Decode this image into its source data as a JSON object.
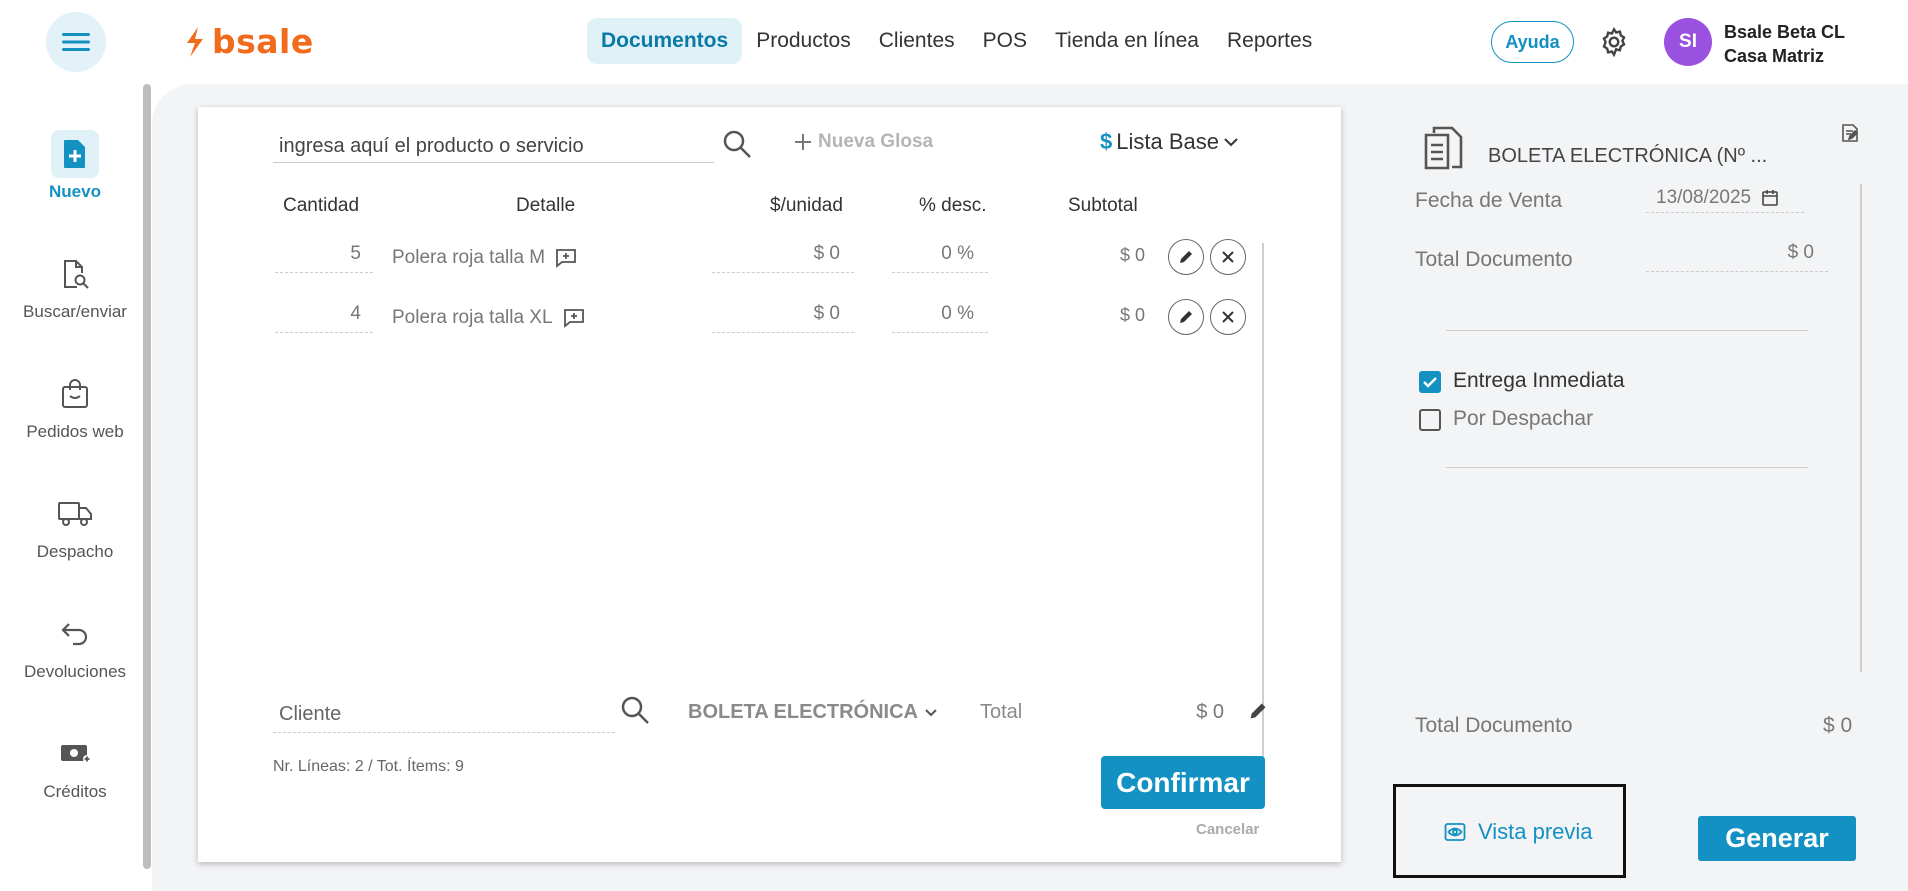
{
  "header": {
    "logo_text": "bsale",
    "nav": [
      {
        "label": "Documentos",
        "active": true
      },
      {
        "label": "Productos",
        "active": false
      },
      {
        "label": "Clientes",
        "active": false
      },
      {
        "label": "POS",
        "active": false
      },
      {
        "label": "Tienda en línea",
        "active": false
      },
      {
        "label": "Reportes",
        "active": false
      }
    ],
    "help_label": "Ayuda",
    "avatar_initials": "SI",
    "user_line1": "Bsale Beta CL",
    "user_line2": "Casa Matriz"
  },
  "sidebar": {
    "items": [
      {
        "label": "Nuevo",
        "icon": "new-document-icon",
        "active": true
      },
      {
        "label": "Buscar/enviar",
        "icon": "search-document-icon",
        "active": false
      },
      {
        "label": "Pedidos web",
        "icon": "shopping-bag-icon",
        "active": false
      },
      {
        "label": "Despacho",
        "icon": "truck-icon",
        "active": false
      },
      {
        "label": "Devoluciones",
        "icon": "return-arrow-icon",
        "active": false
      },
      {
        "label": "Créditos",
        "icon": "money-plus-icon",
        "active": false
      }
    ]
  },
  "editor": {
    "search_placeholder": "ingresa aquí el producto o servicio",
    "new_gloss_label": "Nueva Glosa",
    "price_list_symbol": "$",
    "price_list_label": "Lista Base",
    "columns": {
      "qty": "Cantidad",
      "detail": "Detalle",
      "unit": "$/unidad",
      "discount": "% desc.",
      "subtotal": "Subtotal"
    },
    "lines": [
      {
        "qty": "5",
        "detail": "Polera roja talla M",
        "unit": "$ 0",
        "discount": "0 %",
        "subtotal": "$ 0"
      },
      {
        "qty": "4",
        "detail": "Polera roja talla XL",
        "unit": "$ 0",
        "discount": "0 %",
        "subtotal": "$ 0"
      }
    ],
    "client_placeholder": "Cliente",
    "document_type": "BOLETA ELECTRÓNICA",
    "total_label": "Total",
    "total_value": "$ 0",
    "summary": "Nr. Líneas: 2 / Tot. Ítems: 9",
    "confirm_label": "Confirmar",
    "cancel_label": "Cancelar"
  },
  "panel": {
    "document_title": "BOLETA ELECTRÓNICA (Nº ...",
    "sale_date_label": "Fecha de Venta",
    "sale_date_value": "13/08/2025",
    "total_doc_label": "Total Documento",
    "total_doc_value": "$ 0",
    "delivery_options": [
      {
        "label": "Entrega Inmediata",
        "checked": true
      },
      {
        "label": "Por Despachar",
        "checked": false
      }
    ],
    "footer_total_label": "Total Documento",
    "footer_total_value": "$ 0",
    "preview_label": "Vista previa",
    "generate_label": "Generar"
  },
  "colors": {
    "accent": "#1391c2",
    "brand": "#f26a1b",
    "avatar": "#9b51e0"
  }
}
